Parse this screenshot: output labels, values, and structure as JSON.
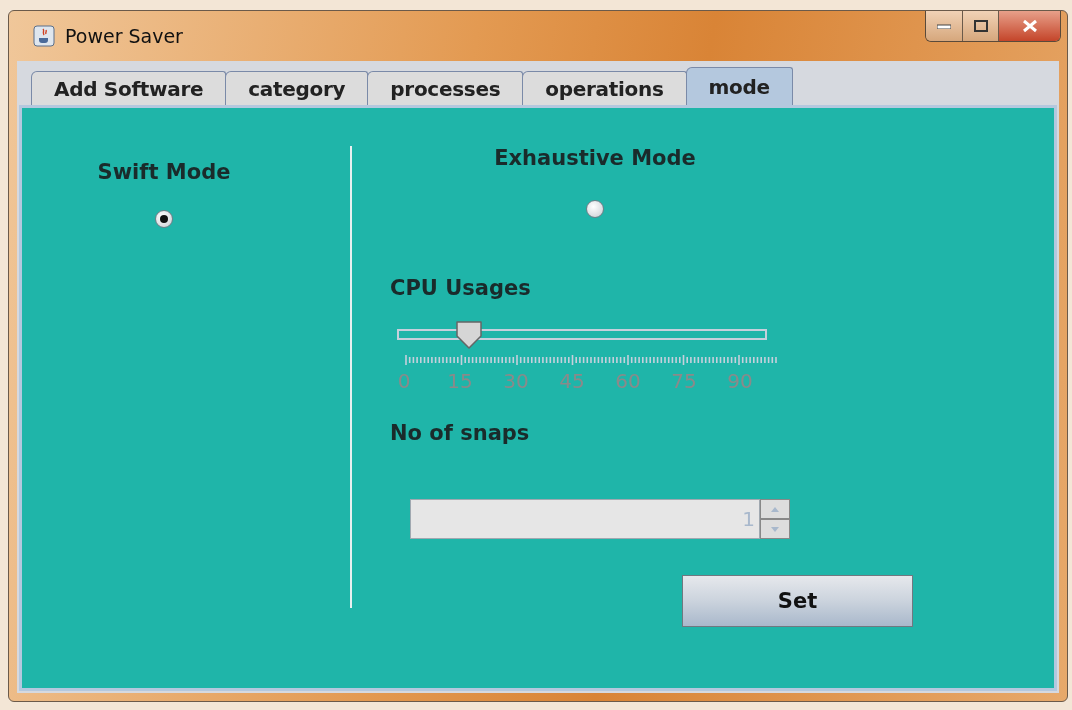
{
  "window": {
    "title": "Power Saver"
  },
  "tabs": [
    {
      "label": "Add Software",
      "selected": false
    },
    {
      "label": "category",
      "selected": false
    },
    {
      "label": "processes",
      "selected": false
    },
    {
      "label": "operations",
      "selected": false
    },
    {
      "label": "mode",
      "selected": true
    }
  ],
  "swift_mode": {
    "label": "Swift Mode",
    "selected": true
  },
  "exhaustive_mode": {
    "label": "Exhaustive Mode",
    "selected": false
  },
  "cpu_usage": {
    "label": "CPU Usages",
    "level": 0.19,
    "disabled": true,
    "tick_labels": [
      "0",
      "15",
      "30",
      "45",
      "60",
      "75",
      "90"
    ]
  },
  "snaps": {
    "label": "No of snaps",
    "value": "1",
    "disabled": true
  },
  "set_button": {
    "label": "Set"
  }
}
